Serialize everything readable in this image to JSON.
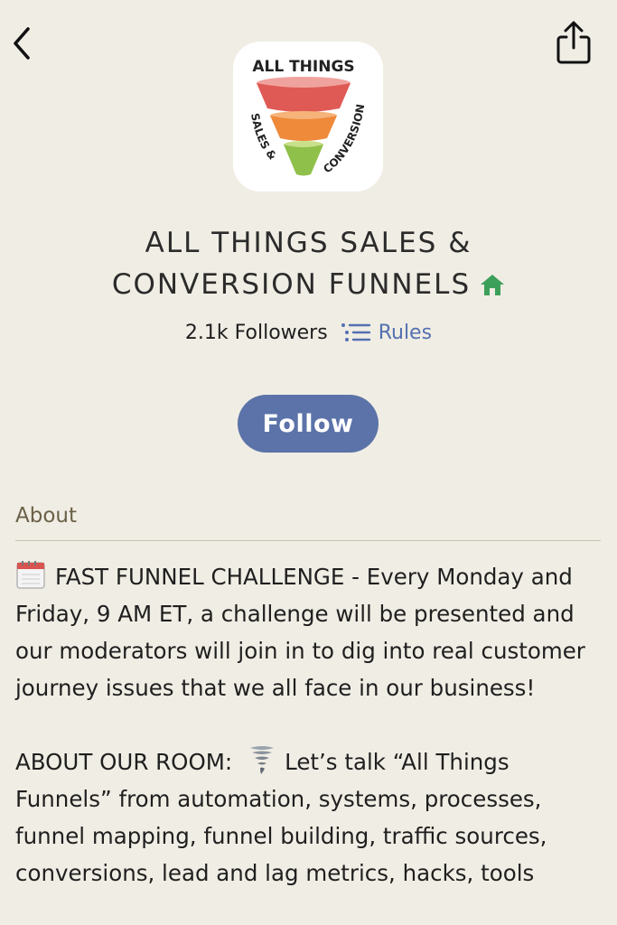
{
  "nav": {
    "back_icon": "chevron-left-icon",
    "share_icon": "share-icon"
  },
  "club": {
    "logo_text": {
      "top": "ALL THINGS",
      "left": "SALES &",
      "right": "CONVERSION"
    },
    "name_line1": "ALL THINGS SALES &",
    "name_line2": "CONVERSION FUNNELS",
    "house_icon": "house-icon",
    "house_color": "#3da05a",
    "followers": "2.1k Followers",
    "rules_label": "Rules",
    "rules_icon": "list-icon",
    "follow_label": "Follow",
    "accent_color": "#5b73a8"
  },
  "about": {
    "heading": "About",
    "paragraph1": "FAST FUNNEL CHALLENGE - Every Monday and Friday, 9 AM ET, a challenge will be presented and our moderators will join in to dig into real customer journey issues that we all face in our business!",
    "paragraph1_icon": "calendar-icon",
    "paragraph2_prefix": "ABOUT OUR ROOM:",
    "paragraph2_icon": "tornado-icon",
    "paragraph2_body": "Let’s talk “All Things Funnels” from automation, systems, processes, funnel mapping, funnel building, traffic sources, conversions, lead and lag metrics, hacks, tools"
  }
}
